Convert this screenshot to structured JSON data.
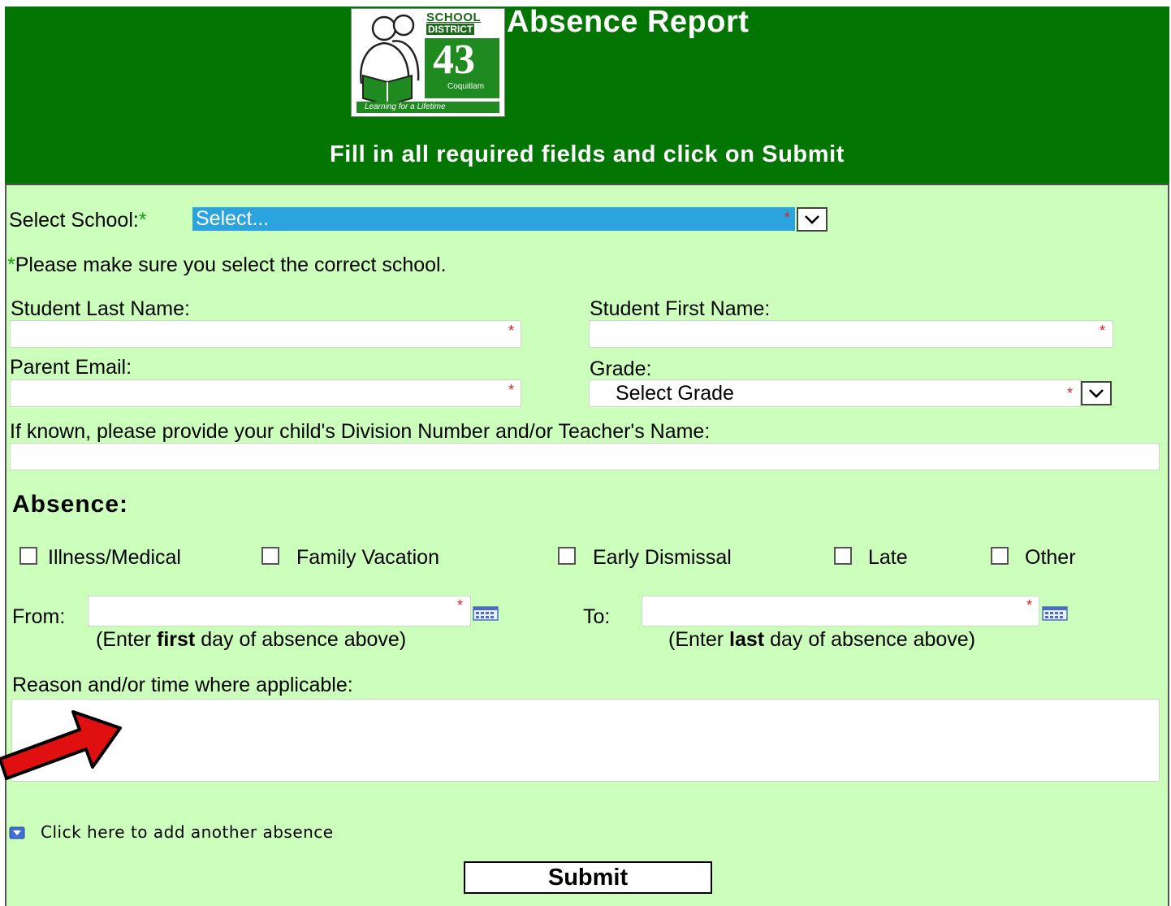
{
  "header": {
    "title": "Absence Report",
    "subtitle": "Fill in all required fields and click on Submit",
    "logo": {
      "line1": "SCHOOL",
      "line2": "DISTRICT",
      "number": "43",
      "city": "Coquitlam",
      "tagline": "Learning for a Lifetime"
    }
  },
  "form": {
    "school_label": "Select School:",
    "school_required_mark": "*",
    "school_value": "Select...",
    "school_note": "*Please make sure you select the correct school.",
    "last_name_label": "Student Last Name:",
    "first_name_label": "Student First Name:",
    "email_label": "Parent Email:",
    "grade_label": "Grade:",
    "grade_value": "Select Grade",
    "division_label": "If known, please provide your child's Division Number and/or Teacher's Name:",
    "required_mark": "*"
  },
  "absence": {
    "heading": "Absence:",
    "types": [
      "Illness/Medical",
      "Family Vacation",
      "Early Dismissal",
      "Late",
      "Other"
    ],
    "from_label": "From:",
    "to_label": "To:",
    "from_hint_pre": "(Enter ",
    "from_hint_bold": "first",
    "from_hint_post": " day of absence above)",
    "to_hint_pre": "(Enter ",
    "to_hint_bold": "last",
    "to_hint_post": " day of absence above)",
    "reason_label": "Reason and/or time where applicable:"
  },
  "add_absence_link": "Click here to add another absence",
  "submit_label": "Submit",
  "colors": {
    "header": "#027502",
    "form_background": "#ccffbb",
    "select_highlight": "#2aa3de",
    "arrow": "#e01010"
  }
}
